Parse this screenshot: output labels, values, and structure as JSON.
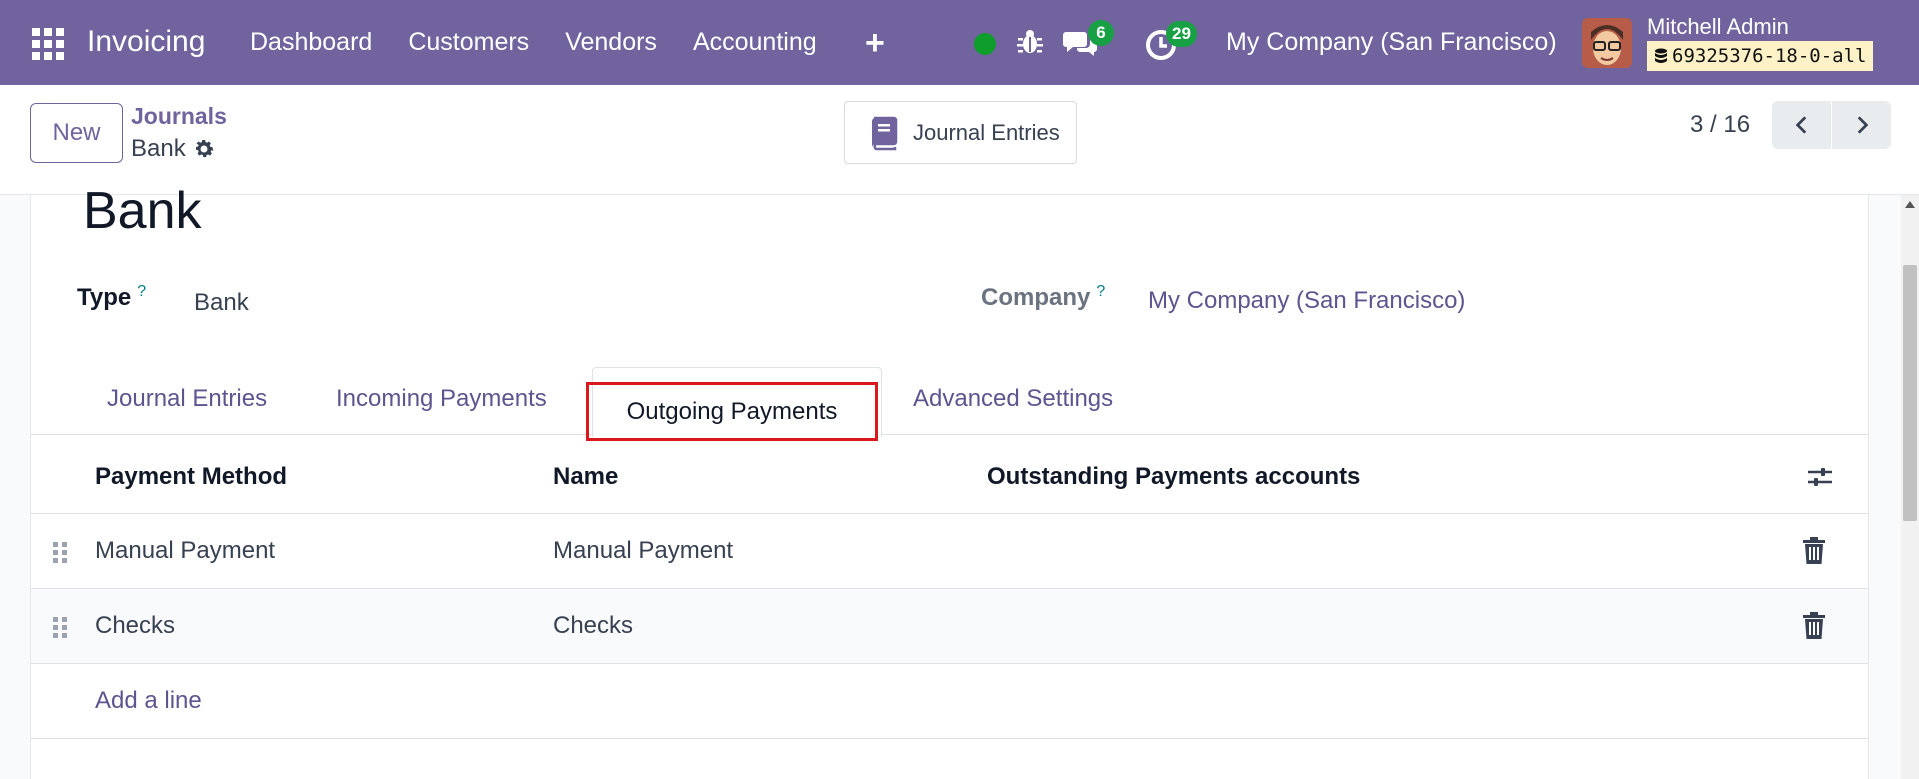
{
  "nav": {
    "app_name": "Invoicing",
    "menu": [
      "Dashboard",
      "Customers",
      "Vendors",
      "Accounting"
    ],
    "plus": "+",
    "chat_count": "6",
    "activity_count": "29",
    "company": "My Company (San Francisco)",
    "user_name": "Mitchell Admin",
    "db_name": "69325376-18-0-all",
    "status_color": "#0d9e2b",
    "brand_color": "#71639e"
  },
  "control": {
    "new_label": "New",
    "breadcrumb_parent": "Journals",
    "breadcrumb_current": "Bank",
    "smart_button": "Journal Entries",
    "pager": "3 / 16"
  },
  "form": {
    "title": "Bank",
    "type_label": "Type",
    "type_value": "Bank",
    "company_label": "Company",
    "company_value": "My Company (San Francisco)",
    "help_mark": "?",
    "tabs": [
      "Journal Entries",
      "Incoming Payments",
      "Outgoing Payments",
      "Advanced Settings"
    ],
    "active_tab": "Outgoing Payments",
    "highlight_color": "#d9191e"
  },
  "table": {
    "headers": [
      "Payment Method",
      "Name",
      "Outstanding Payments accounts"
    ],
    "rows": [
      {
        "method": "Manual Payment",
        "name": "Manual Payment",
        "account": ""
      },
      {
        "method": "Checks",
        "name": "Checks",
        "account": ""
      }
    ],
    "add_line": "Add a line"
  }
}
